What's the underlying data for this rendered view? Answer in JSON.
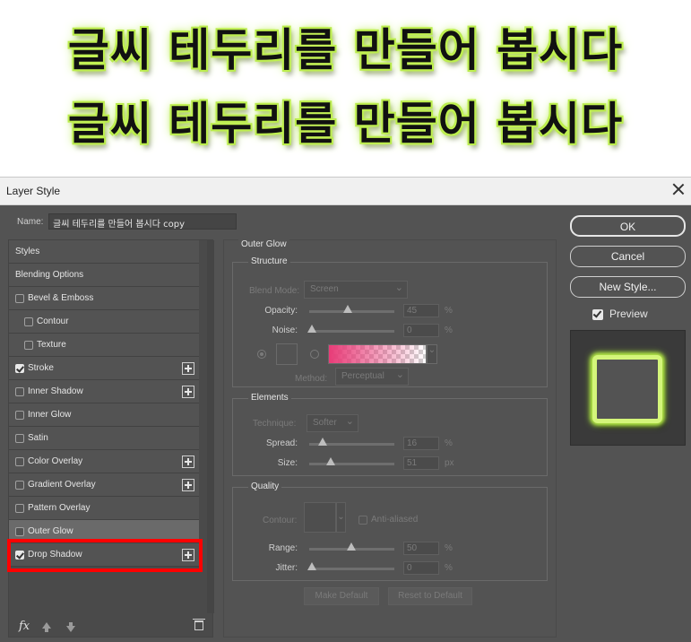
{
  "banner": {
    "line1": "글씨 테두리를 만들어 봅시다",
    "line2": "글씨 테두리를 만들어 봅시다",
    "glow_color": "#c8f55a"
  },
  "dialog": {
    "title": "Layer Style",
    "name_label": "Name:",
    "name_value": "글씨 테두리를 만들어 봅시다 copy"
  },
  "left_list": {
    "items": [
      {
        "label": "Styles",
        "checkbox": null,
        "plus": false
      },
      {
        "label": "Blending Options",
        "checkbox": null,
        "plus": false
      },
      {
        "label": "Bevel & Emboss",
        "checkbox": false,
        "plus": false
      },
      {
        "label": "Contour",
        "checkbox": false,
        "plus": false
      },
      {
        "label": "Texture",
        "checkbox": false,
        "plus": false
      },
      {
        "label": "Stroke",
        "checkbox": true,
        "plus": true
      },
      {
        "label": "Inner Shadow",
        "checkbox": false,
        "plus": true
      },
      {
        "label": "Inner Glow",
        "checkbox": false,
        "plus": false
      },
      {
        "label": "Satin",
        "checkbox": false,
        "plus": false
      },
      {
        "label": "Color Overlay",
        "checkbox": false,
        "plus": true
      },
      {
        "label": "Gradient Overlay",
        "checkbox": false,
        "plus": true
      },
      {
        "label": "Pattern Overlay",
        "checkbox": false,
        "plus": false
      },
      {
        "label": "Outer Glow",
        "checkbox": false,
        "plus": false,
        "selected": true
      },
      {
        "label": "Drop Shadow",
        "checkbox": true,
        "plus": true,
        "highlighted": true
      }
    ],
    "fx_label": "fx"
  },
  "outer_glow": {
    "title": "Outer Glow",
    "structure": {
      "legend": "Structure",
      "blend_mode_label": "Blend Mode:",
      "blend_mode_value": "Screen",
      "opacity_label": "Opacity:",
      "opacity_value": "45",
      "opacity_unit": "%",
      "noise_label": "Noise:",
      "noise_value": "0",
      "noise_unit": "%",
      "gradient_start_color": "#e83c78"
    },
    "elements": {
      "legend": "Elements",
      "technique_label": "Technique:",
      "technique_value": "Softer",
      "spread_label": "Spread:",
      "spread_value": "16",
      "spread_unit": "%",
      "size_label": "Size:",
      "size_value": "51",
      "size_unit": "px"
    },
    "quality": {
      "legend": "Quality",
      "contour_label": "Contour:",
      "anti_aliased_label": "Anti-aliased",
      "range_label": "Range:",
      "range_value": "50",
      "range_unit": "%",
      "jitter_label": "Jitter:",
      "jitter_value": "0",
      "jitter_unit": "%",
      "method_label": "Method:",
      "method_value": "Perceptual"
    },
    "make_default": "Make Default",
    "reset_default": "Reset to Default"
  },
  "right": {
    "ok": "OK",
    "cancel": "Cancel",
    "new_style": "New Style...",
    "preview_label": "Preview",
    "preview_checked": true,
    "preview_glow_color": "#d4f57a"
  }
}
